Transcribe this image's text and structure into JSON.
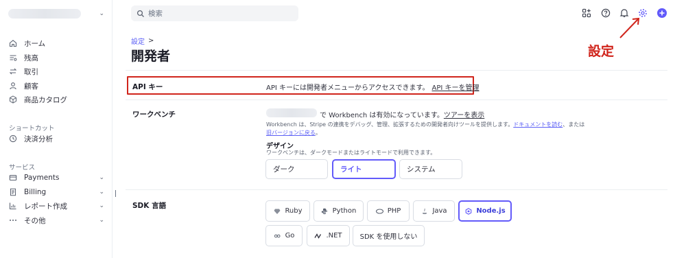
{
  "sidebar": {
    "nav": [
      {
        "label": "ホーム",
        "icon": "home-icon"
      },
      {
        "label": "残高",
        "icon": "balance-icon"
      },
      {
        "label": "取引",
        "icon": "transactions-icon"
      },
      {
        "label": "顧客",
        "icon": "customers-icon"
      },
      {
        "label": "商品カタログ",
        "icon": "product-catalog-icon"
      }
    ],
    "shortcuts_title": "ショートカット",
    "shortcuts": [
      {
        "label": "決済分析",
        "icon": "payment-analytics-icon"
      }
    ],
    "services_title": "サービス",
    "services": [
      {
        "label": "Payments",
        "icon": "payments-icon"
      },
      {
        "label": "Billing",
        "icon": "billing-icon"
      },
      {
        "label": "レポート作成",
        "icon": "reporting-icon"
      },
      {
        "label": "その他",
        "icon": "more-icon"
      }
    ]
  },
  "search": {
    "placeholder": "検索"
  },
  "topbar_icons": [
    "apps-icon",
    "help-icon",
    "notifications-icon",
    "settings-icon",
    "create-icon"
  ],
  "annotation": {
    "label": "設定"
  },
  "breadcrumb": {
    "parent": "設定",
    "separator": ">"
  },
  "page": {
    "title": "開発者"
  },
  "api_keys": {
    "label": "API キー",
    "text": "API キーには開発者メニューからアクセスできます。",
    "link": "API キーを管理"
  },
  "workbench": {
    "label": "ワークベンチ",
    "status_text": "で Workbench は有効になっています。",
    "status_link": "ツアーを表示",
    "desc_text": "Workbench は、Stripe の連携をデバッグ、管理、拡張するための開発者向けツールを提供します。",
    "desc_link1": "ドキュメントを読む",
    "desc_mid": "、または",
    "desc_link2": "旧バージョンに戻る",
    "desc_end": "。",
    "design_title": "デザイン",
    "design_desc": "ワークベンチは、ダークモードまたはライトモードで利用できます。",
    "design_options": [
      "ダーク",
      "ライト",
      "システム"
    ],
    "design_selected": "ライト"
  },
  "sdk": {
    "label": "SDK 言語",
    "options": [
      {
        "label": "Ruby",
        "icon": "ruby-icon"
      },
      {
        "label": "Python",
        "icon": "python-icon"
      },
      {
        "label": "PHP",
        "icon": "php-icon"
      },
      {
        "label": "Java",
        "icon": "java-icon"
      },
      {
        "label": "Node.js",
        "icon": "nodejs-icon"
      },
      {
        "label": "Go",
        "icon": "go-icon"
      },
      {
        "label": ".NET",
        "icon": "dotnet-icon"
      },
      {
        "label": "SDK を使用しない",
        "icon": ""
      }
    ],
    "selected": "Node.js"
  },
  "colors": {
    "accent": "#625afa",
    "annotation": "#d0241b",
    "link": "#5b5ff5"
  }
}
